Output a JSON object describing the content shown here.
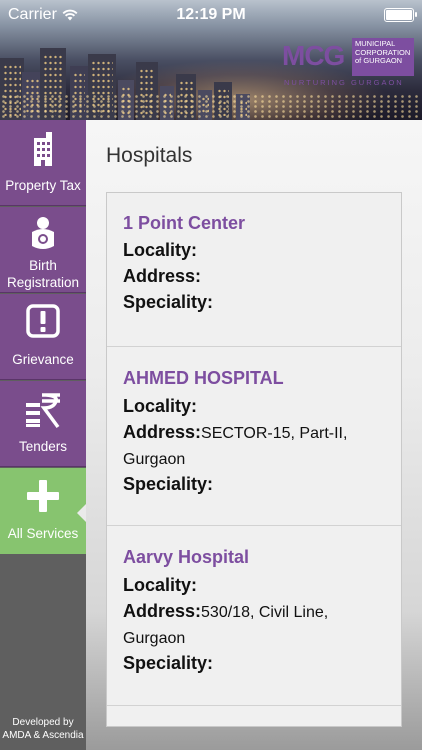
{
  "status_bar": {
    "carrier": "Carrier",
    "time": "12:19 PM"
  },
  "logo": {
    "abbr": "MCG",
    "line1": "MUNICIPAL",
    "line2": "CORPORATION",
    "line3": "of GURGAON",
    "tagline": "NURTURING GURGAON",
    "brand_color": "#7d4ea0"
  },
  "sidebar": {
    "items": [
      {
        "label": "Property Tax",
        "icon": "building-icon"
      },
      {
        "label": "Birth Registration",
        "icon": "baby-icon"
      },
      {
        "label": "Grievance",
        "icon": "alert-icon"
      },
      {
        "label": "Tenders",
        "icon": "rupee-icon"
      },
      {
        "label": "All Services",
        "icon": "plus-icon",
        "active": true
      }
    ],
    "developer_credit": {
      "line1": "Developed by",
      "line2": "AMDA &  Ascendia"
    },
    "item_color": "#7a4d8c",
    "active_color": "#87c46f"
  },
  "page": {
    "title": "Hospitals"
  },
  "field_labels": {
    "locality": "Locality:",
    "address": "Address:",
    "speciality": "Speciality:"
  },
  "hospitals": [
    {
      "name": "1 Point Center",
      "locality": "",
      "address": "",
      "speciality": ""
    },
    {
      "name": "AHMED HOSPITAL",
      "locality": "",
      "address": "SECTOR-15, Part-II, Gurgaon",
      "speciality": ""
    },
    {
      "name": "Aarvy Hospital",
      "locality": "",
      "address": "530/18, Civil Line, Gurgaon",
      "speciality": ""
    }
  ]
}
